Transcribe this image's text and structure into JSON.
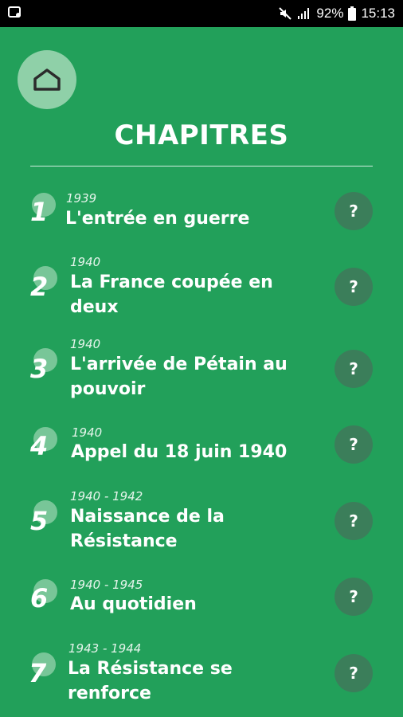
{
  "status": {
    "battery": "92%",
    "time": "15:13"
  },
  "header": {
    "title": "CHAPITRES"
  },
  "chapters": [
    {
      "number": "1",
      "years": "1939",
      "label": "L'entrée en guerre",
      "help": "?"
    },
    {
      "number": "2",
      "years": "1940",
      "label": "La France coupée en deux",
      "help": "?"
    },
    {
      "number": "3",
      "years": "1940",
      "label": "L'arrivée de Pétain au pouvoir",
      "help": "?"
    },
    {
      "number": "4",
      "years": "1940",
      "label": "Appel du 18 juin 1940",
      "help": "?"
    },
    {
      "number": "5",
      "years": "1940 - 1942",
      "label": "Naissance de la Résistance",
      "help": "?"
    },
    {
      "number": "6",
      "years": "1940 - 1945",
      "label": "Au quotidien",
      "help": "?"
    },
    {
      "number": "7",
      "years": "1943 - 1944",
      "label": "La Résistance se renforce",
      "help": "?"
    }
  ],
  "icons": {
    "home": "home-icon",
    "status_left": "photo-status-icon",
    "mute": "mute-icon",
    "signal": "signal-icon",
    "battery": "battery-icon"
  }
}
